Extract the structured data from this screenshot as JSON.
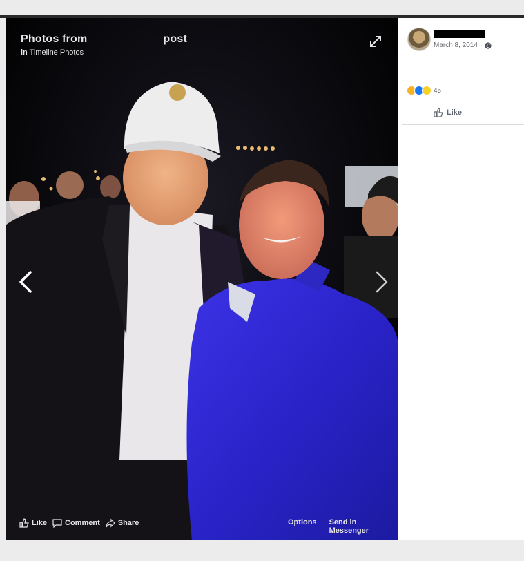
{
  "viewer": {
    "title_left": "Photos from",
    "title_right": "post",
    "subtitle_prefix": "in",
    "subtitle": "Timeline Photos",
    "icons": {
      "expand": "expand-icon",
      "prev": "chevron-left-icon",
      "next": "chevron-right-icon"
    },
    "actions": {
      "like": "Like",
      "comment": "Comment",
      "share": "Share",
      "options": "Options",
      "send": "Send in Messenger"
    }
  },
  "post": {
    "date": "March 8, 2014",
    "privacy_icon": "globe-icon",
    "reaction_count": "45",
    "reactions": [
      "haha",
      "like",
      "wow"
    ],
    "like_label": "Like"
  },
  "colors": {
    "viewer_bg": "#050507",
    "panel_bg": "#ffffff",
    "shirt_blue": "#2a2bd2"
  }
}
